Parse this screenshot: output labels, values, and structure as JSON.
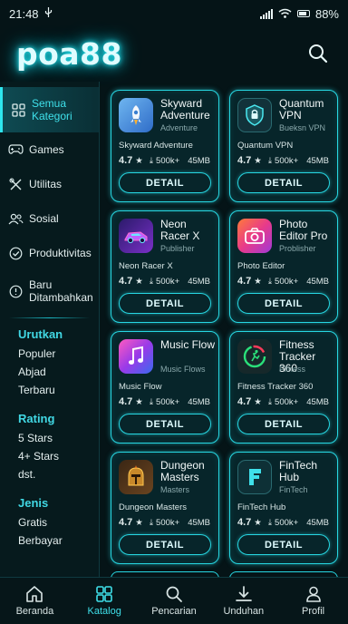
{
  "status": {
    "time": "21:48",
    "battery": "88%"
  },
  "header": {
    "logo": "poa88"
  },
  "sidebar": {
    "categories": [
      {
        "label": "Semua Kategori",
        "icon": "grid-icon"
      },
      {
        "label": "Games",
        "icon": "gamepad-icon"
      },
      {
        "label": "Utilitas",
        "icon": "tools-icon"
      },
      {
        "label": "Sosial",
        "icon": "people-icon"
      },
      {
        "label": "Produktivitas",
        "icon": "check-circle-icon"
      },
      {
        "label": "Baru Ditambahkan",
        "icon": "new-badge-icon"
      }
    ],
    "sort": {
      "title": "Urutkan",
      "items": [
        "Populer",
        "Abjad",
        "Terbaru"
      ]
    },
    "rating": {
      "title": "Rating",
      "items": [
        "5 Stars",
        "4+ Stars",
        "dst."
      ]
    },
    "type": {
      "title": "Jenis",
      "items": [
        "Gratis",
        "Berbayar"
      ]
    }
  },
  "apps": [
    {
      "title": "Skyward Adventure",
      "subtitle": "Adventure",
      "name": "Skyward Adventure",
      "rating": "4.7",
      "downloads": "500k+",
      "size": "45MB",
      "button": "DETAIL",
      "icon": "rocket-icon",
      "color": "#4a8fd8"
    },
    {
      "title": "Quantum VPN",
      "subtitle": "Bueksn VPN",
      "name": "Quantum VPN",
      "rating": "4.7",
      "downloads": "500k+",
      "size": "45MB",
      "button": "DETAIL",
      "icon": "shield-icon",
      "color": "#1c3a44"
    },
    {
      "title": "Neon Racer X",
      "subtitle": "Publisher",
      "name": "Neon Racer X",
      "rating": "4.7",
      "downloads": "500k+",
      "size": "45MB",
      "button": "DETAIL",
      "icon": "race-car-icon",
      "color": "#5a2aa8"
    },
    {
      "title": "Photo Editor Pro",
      "subtitle": "Problisher",
      "name": "Photo Editor",
      "rating": "4.7",
      "downloads": "500k+",
      "size": "45MB",
      "button": "DETAIL",
      "icon": "camera-icon",
      "color": "#e8456e"
    },
    {
      "title": "Music Flow",
      "subtitle": "Music Flows",
      "name": "Music Flow",
      "rating": "4.7",
      "downloads": "500k+",
      "size": "45MB",
      "button": "DETAIL",
      "icon": "music-note-icon",
      "color": "#c43ad8"
    },
    {
      "title": "Fitness Tracker 360",
      "subtitle": "Fitness",
      "name": "Fitness Tracker 360",
      "rating": "4.7",
      "downloads": "500k+",
      "size": "45MB",
      "button": "DETAIL",
      "icon": "runner-icon",
      "color": "#1a2a2c"
    },
    {
      "title": "Dungeon Masters",
      "subtitle": "Masters",
      "name": "Dungeon Masters",
      "rating": "4.7",
      "downloads": "500k+",
      "size": "45MB",
      "button": "DETAIL",
      "icon": "helmet-icon",
      "color": "#3a2a1a"
    },
    {
      "title": "FinTech Hub",
      "subtitle": "FinTech",
      "name": "FinTech Hub",
      "rating": "4.7",
      "downloads": "500k+",
      "size": "45MB",
      "button": "DETAIL",
      "icon": "letter-f-icon",
      "color": "#123a40"
    }
  ],
  "nav": [
    {
      "label": "Beranda",
      "icon": "home-icon",
      "active": false
    },
    {
      "label": "Katalog",
      "icon": "catalog-icon",
      "active": true
    },
    {
      "label": "Pencarian",
      "icon": "search-icon",
      "active": false
    },
    {
      "label": "Unduhan",
      "icon": "download-icon",
      "active": false
    },
    {
      "label": "Profil",
      "icon": "profile-icon",
      "active": false
    }
  ],
  "colors": {
    "accent": "#27d7e2",
    "background": "#051417",
    "section_title": "#41d8e4"
  }
}
